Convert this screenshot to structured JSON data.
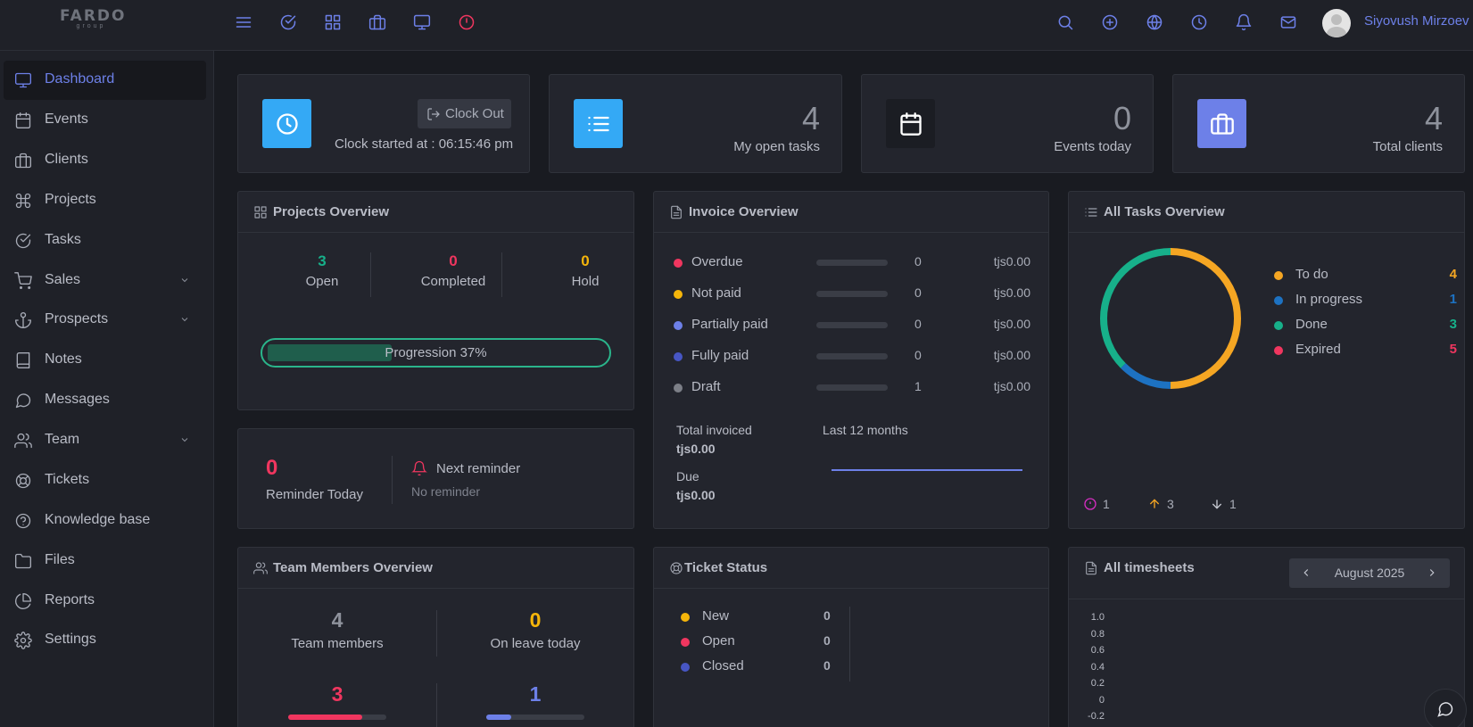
{
  "logo": {
    "name": "FARDO",
    "tagline": "group"
  },
  "user": {
    "name": "Siyovush Mirzoev"
  },
  "sidebar": {
    "items": [
      {
        "label": "Dashboard",
        "icon": "monitor-icon",
        "active": true
      },
      {
        "label": "Events",
        "icon": "calendar-icon"
      },
      {
        "label": "Clients",
        "icon": "briefcase-icon"
      },
      {
        "label": "Projects",
        "icon": "command-icon"
      },
      {
        "label": "Tasks",
        "icon": "check-circle-icon"
      },
      {
        "label": "Sales",
        "icon": "cart-icon",
        "has_submenu": true
      },
      {
        "label": "Prospects",
        "icon": "anchor-icon",
        "has_submenu": true
      },
      {
        "label": "Notes",
        "icon": "book-icon"
      },
      {
        "label": "Messages",
        "icon": "message-icon"
      },
      {
        "label": "Team",
        "icon": "users-icon",
        "has_submenu": true
      },
      {
        "label": "Tickets",
        "icon": "life-buoy-icon"
      },
      {
        "label": "Knowledge base",
        "icon": "help-circle-icon"
      },
      {
        "label": "Files",
        "icon": "folder-icon"
      },
      {
        "label": "Reports",
        "icon": "pie-chart-icon"
      },
      {
        "label": "Settings",
        "icon": "gear-icon"
      }
    ]
  },
  "clock": {
    "button_label": "Clock Out",
    "started_text": "Clock started at : 06:15:46 pm"
  },
  "stats": {
    "open_tasks": {
      "value": "4",
      "label": "My open tasks"
    },
    "events_today": {
      "value": "0",
      "label": "Events today"
    },
    "total_clients": {
      "value": "4",
      "label": "Total clients"
    }
  },
  "projects_overview": {
    "title": "Projects Overview",
    "open": {
      "value": "3",
      "label": "Open"
    },
    "completed": {
      "value": "0",
      "label": "Completed"
    },
    "hold": {
      "value": "0",
      "label": "Hold"
    },
    "progression_text": "Progression 37%",
    "progression_pct": 37
  },
  "reminder": {
    "count": "0",
    "today_label": "Reminder Today",
    "next_label": "Next reminder",
    "none_label": "No reminder"
  },
  "invoice_overview": {
    "title": "Invoice Overview",
    "rows": [
      {
        "label": "Overdue",
        "count": "0",
        "amount": "tjs0.00",
        "color": "#f0365f"
      },
      {
        "label": "Not paid",
        "count": "0",
        "amount": "tjs0.00",
        "color": "#f5b50a"
      },
      {
        "label": "Partially paid",
        "count": "0",
        "amount": "tjs0.00",
        "color": "#6d80e8"
      },
      {
        "label": "Fully paid",
        "count": "0",
        "amount": "tjs0.00",
        "color": "#4756c4"
      },
      {
        "label": "Draft",
        "count": "1",
        "amount": "tjs0.00",
        "color": "#7c7f87"
      }
    ],
    "total_invoiced_label": "Total invoiced",
    "total_invoiced_value": "tjs0.00",
    "due_label": "Due",
    "due_value": "tjs0.00",
    "period_label": "Last 12 months"
  },
  "tasks_overview": {
    "title": "All Tasks Overview",
    "legend": [
      {
        "label": "To do",
        "value": "4",
        "color": "#f5a623"
      },
      {
        "label": "In progress",
        "value": "1",
        "color": "#1d72c2"
      },
      {
        "label": "Done",
        "value": "3",
        "color": "#17b08a"
      },
      {
        "label": "Expired",
        "value": "5",
        "color": "#f0365f"
      }
    ],
    "footer": {
      "priority_count": "1",
      "up_count": "3",
      "down_count": "1"
    }
  },
  "team_overview": {
    "title": "Team Members Overview",
    "members": {
      "value": "4",
      "label": "Team members"
    },
    "on_leave": {
      "value": "0",
      "label": "On leave today"
    },
    "stat_a": {
      "value": "3",
      "fill_pct": 75
    },
    "stat_b": {
      "value": "1",
      "fill_pct": 25
    }
  },
  "ticket_status": {
    "title": "Ticket Status",
    "rows": [
      {
        "label": "New",
        "value": "0",
        "color": "#f5b50a"
      },
      {
        "label": "Open",
        "value": "0",
        "color": "#f0365f"
      },
      {
        "label": "Closed",
        "value": "0",
        "color": "#4756c4"
      }
    ]
  },
  "timesheets": {
    "title": "All timesheets",
    "month": "August 2025",
    "y_ticks": [
      "1.0",
      "0.8",
      "0.6",
      "0.4",
      "0.2",
      "0",
      "-0.2"
    ]
  }
}
